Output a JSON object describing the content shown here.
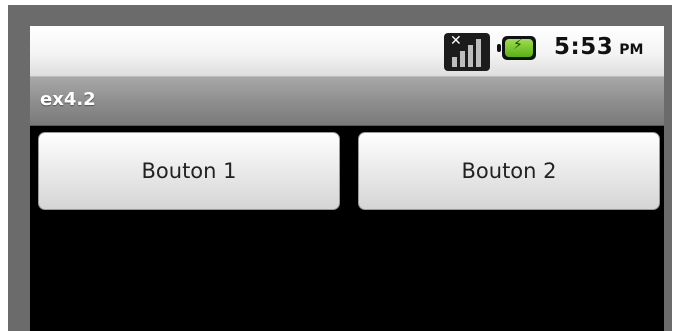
{
  "status_bar": {
    "time": "5:53",
    "ampm": "PM",
    "signal_icon": "no-signal-icon",
    "battery_icon": "battery-charging-icon",
    "battery_bolt": "⚡"
  },
  "title_bar": {
    "title": "ex4.2"
  },
  "buttons": [
    {
      "label": "Bouton 1"
    },
    {
      "label": "Bouton 2"
    }
  ]
}
